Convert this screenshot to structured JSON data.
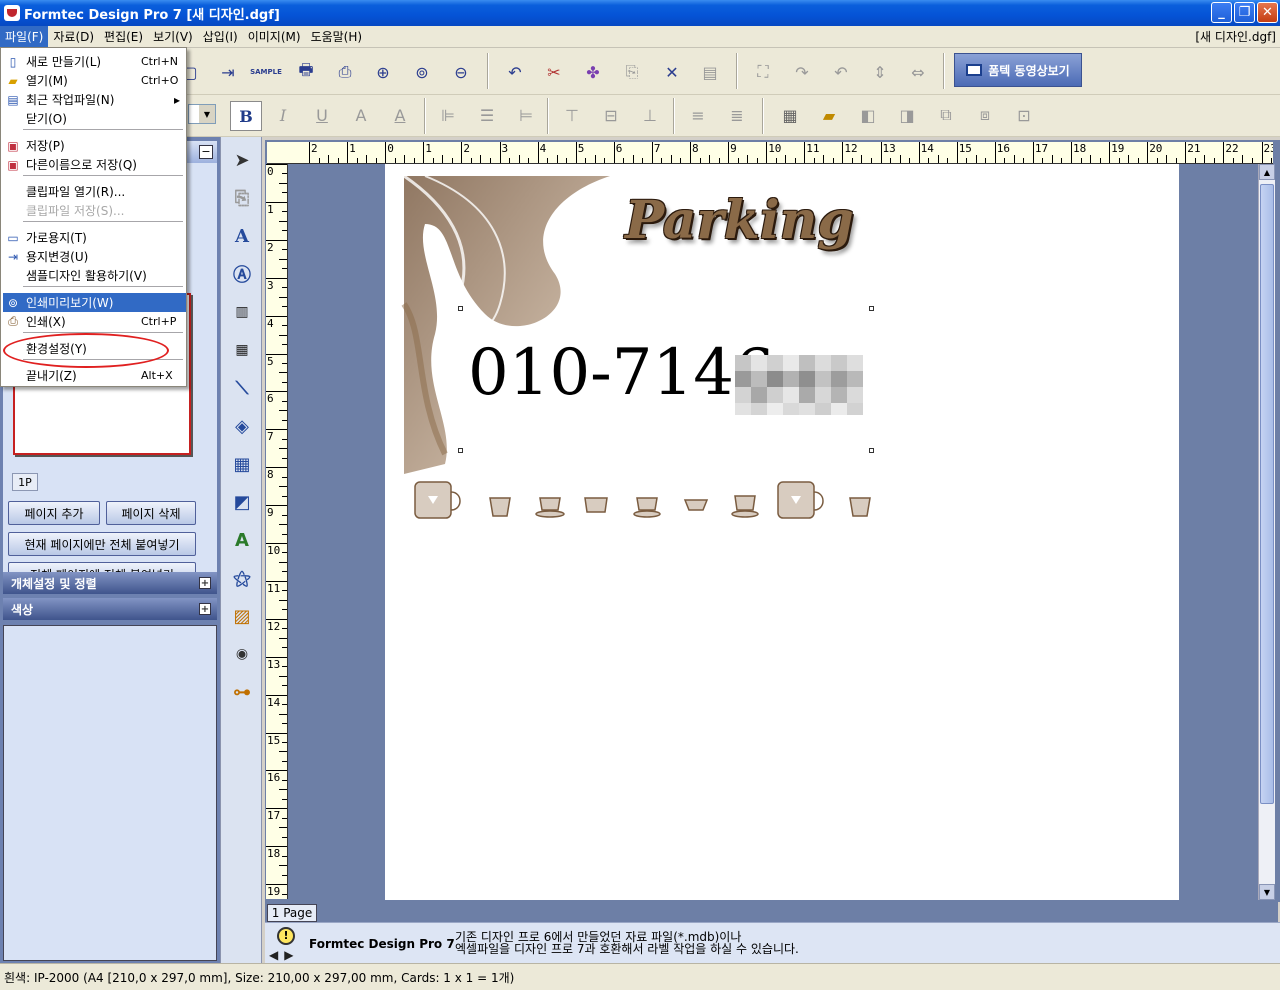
{
  "window": {
    "title": "Formtec Design Pro 7 [새 디자인.dgf]",
    "min": "_",
    "max": "❐",
    "close": "✕"
  },
  "menubar": {
    "items": [
      "파일(F)",
      "자료(D)",
      "편집(E)",
      "보기(V)",
      "삽입(I)",
      "이미지(M)",
      "도움말(H)"
    ],
    "doc_name": "[새 디자인.dgf]"
  },
  "toolbar": {
    "video_button": "폼텍 동영상보기",
    "bold": "B",
    "sample_label": "SAMPLE"
  },
  "file_menu": {
    "items": [
      {
        "label": "새로 만들기(L)",
        "shortcut": "Ctrl+N",
        "icon": "new-doc-icon"
      },
      {
        "label": "열기(M)",
        "shortcut": "Ctrl+O",
        "icon": "open-folder-icon"
      },
      {
        "label": "최근 작업파일(N)",
        "shortcut": "",
        "icon": "recent-icon",
        "submenu": "▸"
      },
      {
        "label": "닫기(O)",
        "shortcut": "",
        "icon": ""
      },
      {
        "label": "저장(P)",
        "shortcut": "",
        "icon": "save-icon"
      },
      {
        "label": "다른이름으로 저장(Q)",
        "shortcut": "",
        "icon": "save-as-icon"
      },
      {
        "label": "클립파일 열기(R)...",
        "shortcut": "",
        "icon": ""
      },
      {
        "label": "클립파일 저장(S)...",
        "shortcut": "",
        "icon": "",
        "disabled": true
      },
      {
        "label": "가로용지(T)",
        "shortcut": "",
        "icon": "landscape-icon"
      },
      {
        "label": "용지변경(U)",
        "shortcut": "",
        "icon": "paper-change-icon"
      },
      {
        "label": "샘플디자인 활용하기(V)",
        "shortcut": "",
        "icon": ""
      },
      {
        "label": "인쇄미리보기(W)",
        "shortcut": "",
        "icon": "print-preview-icon",
        "highlighted": true
      },
      {
        "label": "인쇄(X)",
        "shortcut": "Ctrl+P",
        "icon": "print-icon"
      },
      {
        "label": "환경설정(Y)",
        "shortcut": "",
        "icon": ""
      },
      {
        "label": "끝내기(Z)",
        "shortcut": "Alt+X",
        "icon": ""
      }
    ]
  },
  "left_panel": {
    "page_tab": "1P",
    "add_page": "페이지 추가",
    "delete_page": "페이지 삭제",
    "paste_current": "현재 페이지에만 전체 붙여넣기",
    "paste_all": "전체 페이지에 전체 붙여넣기",
    "section_objects": "개체설정 및 정렬",
    "section_color": "색상"
  },
  "rulers": {
    "horizontal": [
      "2",
      "1",
      "0",
      "1",
      "2",
      "3",
      "4",
      "5",
      "6",
      "7",
      "8",
      "9",
      "10",
      "11",
      "12",
      "13",
      "14",
      "15",
      "16",
      "17",
      "18",
      "19",
      "20",
      "21",
      "22",
      "23"
    ],
    "vertical": [
      "0",
      "1",
      "2",
      "3",
      "4",
      "5",
      "6",
      "7",
      "8",
      "9",
      "10",
      "11",
      "12",
      "13",
      "14",
      "15",
      "16",
      "17",
      "18",
      "19"
    ]
  },
  "design": {
    "heading": "Parking",
    "phone": "010-7146-"
  },
  "page_label": "1 Page",
  "info": {
    "brand": "Formtec Design Pro 7",
    "line1": "기존 디자인 프로 6에서 만들었던 자료 파일(*.mdb)이나",
    "line2": "엑셀파일을 디자인 프로 7과 호환해서 라벨 작업을 하실 수 있습니다."
  },
  "status": "흰색: IP-2000 (A4 [210,0 x 297,0 mm], Size: 210,00 x 297,00 mm,  Cards: 1 x 1 = 1개)",
  "colors": {
    "accent": "#316ac5",
    "titlebar": "#0553d6",
    "panel": "#6d81b0",
    "parking_brown": "#8a6a48",
    "highlight_ellipse": "#e02020"
  }
}
